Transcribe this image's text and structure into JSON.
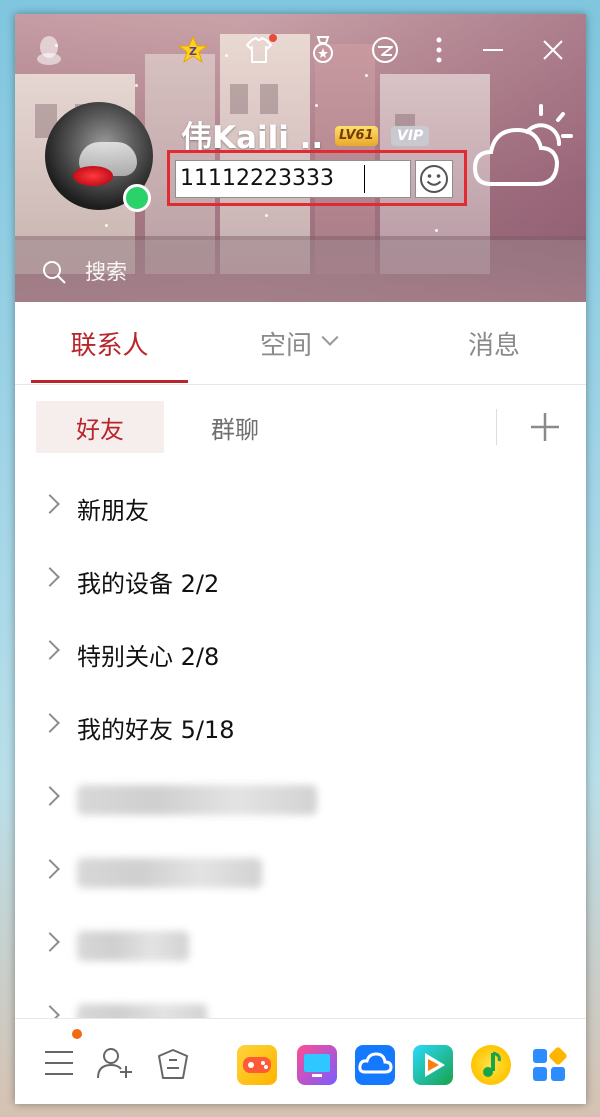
{
  "header": {
    "nickname": "伟Kaili ..",
    "level_badge": "LV61",
    "vip_badge": "VIP",
    "signature_value": "11112223333",
    "search_label": "搜索",
    "online_status_color": "#2ad26a",
    "accent_red": "#e12b30"
  },
  "top_icons": [
    "qq-penguin-icon",
    "star-icon",
    "theme-shirt-icon",
    "medal-icon",
    "qzone-icon",
    "more-icon",
    "minimize-icon",
    "close-icon"
  ],
  "main_tabs": [
    {
      "label": "联系人",
      "active": true
    },
    {
      "label": "空间",
      "active": false
    },
    {
      "label": "消息",
      "active": false
    }
  ],
  "sub_tabs": [
    {
      "label": "好友",
      "active": true
    },
    {
      "label": "群聊",
      "active": false
    }
  ],
  "groups": [
    {
      "label": "新朋友"
    },
    {
      "label": "我的设备 2/2"
    },
    {
      "label": "特别关心 2/8"
    },
    {
      "label": "我的好友 5/18"
    }
  ],
  "bottom_icons": [
    "menu-icon",
    "add-friend-icon",
    "manager-icon",
    "game-icon",
    "screen-icon",
    "weiyun-icon",
    "video-icon",
    "music-icon",
    "apps-icon"
  ]
}
